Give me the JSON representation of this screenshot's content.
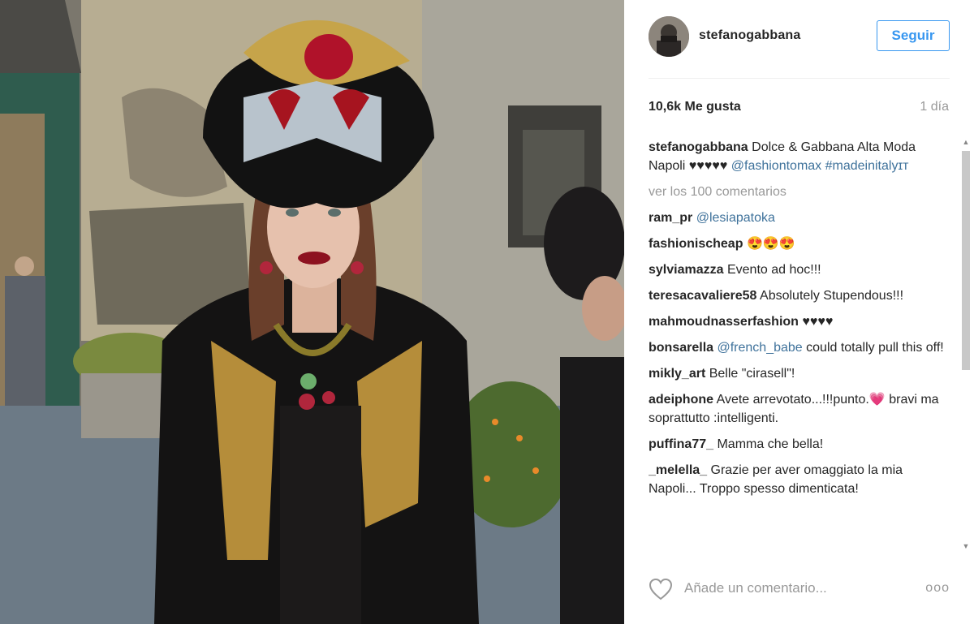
{
  "header": {
    "username": "stefanogabbana",
    "follow_label": "Seguir"
  },
  "stats": {
    "likes": "10,6k Me gusta",
    "time": "1 día"
  },
  "caption": {
    "user": "stefanogabbana",
    "text": "Dolce & Gabbana Alta Moda Napoli ♥♥♥♥♥",
    "mention": "@fashiontomax",
    "hashtag": "#madeinitalyɪᴛ"
  },
  "view_comments": "ver los 100 comentarios",
  "comments": [
    {
      "user": "ram_pr",
      "mention": "@lesiapatoka",
      "text": ""
    },
    {
      "user": "fashionischeap",
      "mention": "",
      "text": "😍😍😍"
    },
    {
      "user": "sylviamazza",
      "mention": "",
      "text": "Evento ad hoc!!!"
    },
    {
      "user": "teresacavaliere58",
      "mention": "",
      "text": "Absolutely Stupendous!!!"
    },
    {
      "user": "mahmoudnasserfashion",
      "mention": "",
      "text": "♥♥♥♥"
    },
    {
      "user": "bonsarella",
      "mention": "@french_babe",
      "text": "could totally pull this off!"
    },
    {
      "user": "mikly_art",
      "mention": "",
      "text": "Belle \"cirasell\"!"
    },
    {
      "user": "adeiphone",
      "mention": "",
      "text": "Avete arrevotato...!!!punto.💗 bravi ma soprattutto :intelligenti."
    },
    {
      "user": "puffina77_",
      "mention": "",
      "text": "Mamma che bella!"
    },
    {
      "user": "_melella_",
      "mention": "",
      "text": "Grazie per aver omaggiato la mia Napoli... Troppo spesso dimenticata!"
    }
  ],
  "footer": {
    "add_comment_placeholder": "Añade un comentario...",
    "more_options": "ooo"
  },
  "icons": {
    "like": "heart-outline-icon",
    "options": "more-options-icon"
  }
}
